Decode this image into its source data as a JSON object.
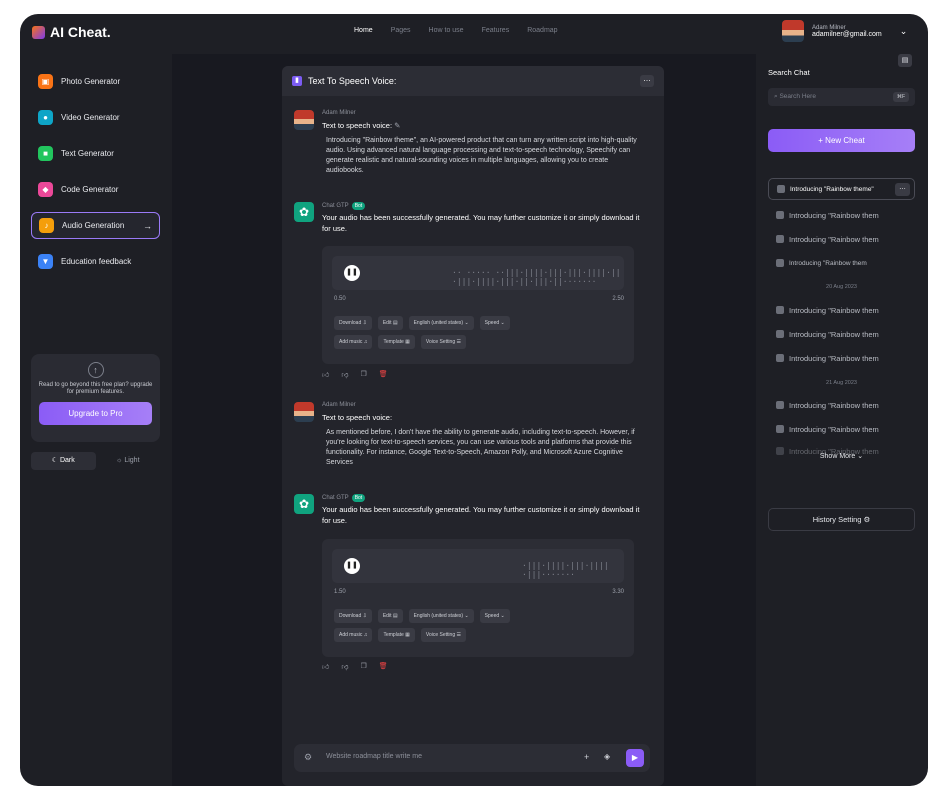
{
  "brand": {
    "logo": "AI Cheat."
  },
  "nav": [
    "Home",
    "Pages",
    "How to use",
    "Features",
    "Roadmap"
  ],
  "user": {
    "name": "Adam Milner",
    "email": "adamilner@gmail.com"
  },
  "sidebar": {
    "items": [
      {
        "label": "Photo Generator",
        "color": "#f97316",
        "icon": "image-icon"
      },
      {
        "label": "Video Generator",
        "color": "#0ea5c7",
        "icon": "video-icon"
      },
      {
        "label": "Text Generator",
        "color": "#22c55e",
        "icon": "text-icon"
      },
      {
        "label": "Code Generator",
        "color": "#ec4899",
        "icon": "code-icon"
      },
      {
        "label": "Audio Generation",
        "color": "#f59e0b",
        "icon": "audio-icon"
      },
      {
        "label": "Education feedback",
        "color": "#3b82f6",
        "icon": "education-icon"
      }
    ],
    "upgrade": {
      "text": "Read to go beyond this free plan? upgrade for premium features.",
      "button": "Upgrade to Pro"
    },
    "theme": {
      "dark": "Dark",
      "light": "Light"
    }
  },
  "chat": {
    "title": "Text To Speech Voice:",
    "messages": [
      {
        "author": "Adam Milner",
        "title": "Text to speech voice:",
        "body": "Introducing \"Rainbow theme\", an AI-powered product that can turn any written script into high-quality audio. Using advanced natural language processing and text-to-speech technology, Speechify can generate realistic and natural-sounding voices in multiple languages, allowing you to create audiobooks."
      },
      {
        "author": "Chat GTP",
        "badge": "Bot",
        "body": "Your audio has been successfully generated. You may further customize it or simply download it for use.",
        "audio": {
          "start": "0.50",
          "end": "2.50"
        }
      },
      {
        "author": "Adam Milner",
        "title": "Text to speech voice:",
        "body": "As mentioned before, I don't have the ability to generate audio, including text-to-speech. However, if you're looking for text-to-speech services, you can use various tools and platforms that provide this functionality. For instance, Google Text-to-Speech, Amazon Polly, and Microsoft Azure Cognitive Services"
      },
      {
        "author": "Chat GTP",
        "badge": "Bot",
        "body": "Your audio has been successfully generated. You may further customize it or simply download it for use.",
        "audio": {
          "start": "1.50",
          "end": "3.30"
        }
      }
    ],
    "chips": {
      "download": "Download",
      "edit": "Edit",
      "language": "English (united states)",
      "speed": "Speed",
      "add_music": "Add music",
      "template": "Template",
      "voice": "Voice Setting"
    },
    "composer_placeholder": "Website roadmap title write me"
  },
  "right": {
    "title": "Search Chat",
    "search_placeholder": "Search Here",
    "shortcut": "⌘F",
    "new_button": "+ New Cheat",
    "history_selected": "Introducing \"Rainbow theme\"",
    "history_item": "Introducing \"Rainbow them",
    "dates": [
      "20 Aug 2023",
      "21 Aug 2023"
    ],
    "show_more": "Show More",
    "history_setting": "History Setting"
  }
}
